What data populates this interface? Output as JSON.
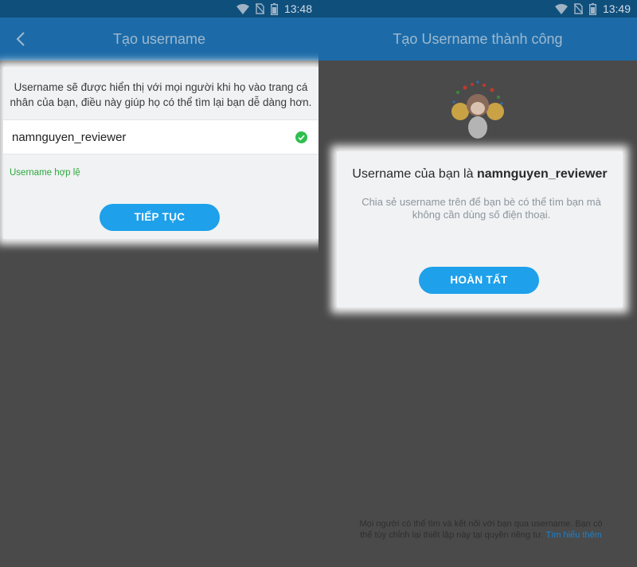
{
  "left_screen": {
    "status": {
      "time": "13:48"
    },
    "title": "Tạo username",
    "description": "Username sẽ được hiển thị với mọi người khi họ vào trang cá nhân của bạn, điều này giúp họ có thể tìm lại bạn dễ dàng hơn.",
    "username_input": {
      "value": "namnguyen_reviewer"
    },
    "validation_message": "Username hợp lệ",
    "continue_button": "TIẾP TỤC"
  },
  "right_screen": {
    "status": {
      "time": "13:49"
    },
    "title": "Tạo Username thành công",
    "heading_prefix": "Username của bạn là ",
    "heading_username": "namnguyen_reviewer",
    "share_text": "Chia sẻ username trên để bạn bè có thể tìm bạn mà không cần dùng số điện thoại.",
    "done_button": "HOÀN TẤT",
    "footer_text": "Mọi người có thể tìm và kết nối với bạn qua username. Bạn có thể tùy chỉnh lại thiết lập này tại quyền riêng tư. ",
    "footer_link": "Tìm hiểu thêm"
  },
  "colors": {
    "status_bar": "#0f4f7c",
    "title_bar": "#1c6ba8",
    "accent_button": "#1ea0ea",
    "valid_green": "#2aa83a",
    "dim_overlay": "#4a4a4a",
    "link": "#1e7fc7"
  },
  "icons": {
    "back": "back-arrow-icon",
    "valid": "check-circle-icon",
    "wifi": "wifi-icon",
    "no_sim": "no-sim-icon",
    "battery": "battery-icon",
    "sticker": "cheerleader-sticker"
  }
}
